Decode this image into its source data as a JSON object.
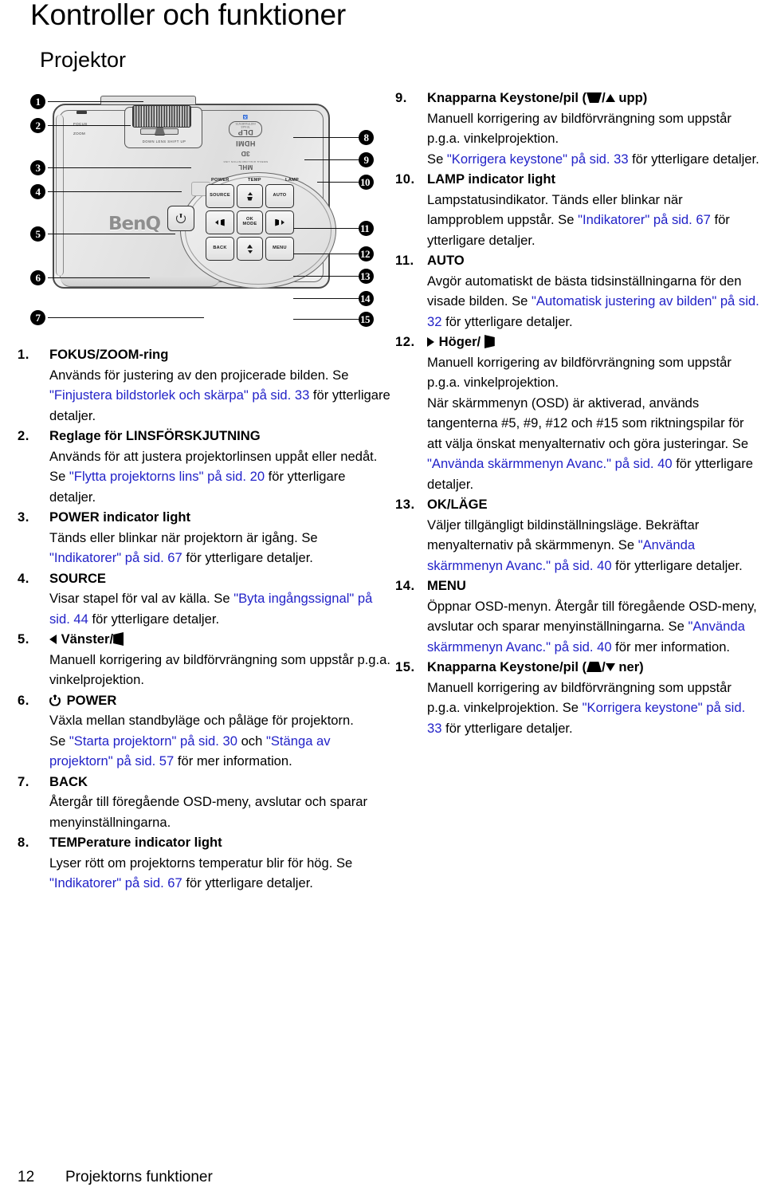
{
  "page": {
    "title": "Kontroller och funktioner",
    "subtitle": "Projektor",
    "footer_page_number": "12",
    "footer_text": "Projektorns funktioner",
    "link_color": "#2222c8"
  },
  "figure": {
    "alt_name": "projector-top-view",
    "brand": "BenQ",
    "logos": [
      {
        "name": "dlp-logo",
        "text": "DLP",
        "sub": "TEXAS INSTRUMENTS"
      },
      {
        "name": "hdmi-logo",
        "text": "HDMI"
      },
      {
        "name": "3d-logo",
        "text": "3D"
      },
      {
        "name": "mhl-logo",
        "text": "MHL",
        "sub": "MOBILE HIGH-DEFINITION LINK"
      }
    ],
    "lens_labels": {
      "focus": "FOCUS",
      "zoom": "ZOOM",
      "slider_scale": "DOWN    LENS SHIFT    UP"
    },
    "indicators": [
      "POWER",
      "TEMP",
      "LAMP"
    ],
    "keys": [
      {
        "name": "source-key",
        "label": "SOURCE"
      },
      {
        "name": "keystone-up-key",
        "label": ""
      },
      {
        "name": "auto-key",
        "label": "AUTO"
      },
      {
        "name": "left-key",
        "label": ""
      },
      {
        "name": "ok-mode-key",
        "label": "OK\nMODE"
      },
      {
        "name": "right-key",
        "label": ""
      },
      {
        "name": "back-key",
        "label": "BACK"
      },
      {
        "name": "keystone-down-key",
        "label": ""
      },
      {
        "name": "menu-key",
        "label": "MENU"
      }
    ],
    "ok_label_top": "OK",
    "ok_label_bottom": "MODE",
    "callouts": [
      "1",
      "2",
      "3",
      "4",
      "5",
      "6",
      "7",
      "8",
      "9",
      "10",
      "11",
      "12",
      "13",
      "14",
      "15"
    ]
  },
  "list_left": [
    {
      "num": "1.",
      "title": "FOKUS/ZOOM-ring",
      "parts": [
        {
          "t": "Används för justering av den projicerade bilden. Se ",
          "link": false
        },
        {
          "t": "\"Finjustera bildstorlek och skärpa\" på sid. 33",
          "link": true
        },
        {
          "t": " för ytterligare detaljer.",
          "link": false
        }
      ]
    },
    {
      "num": "2.",
      "title": "Reglage för LINSFÖRSKJUTNING",
      "parts": [
        {
          "t": "Används för att justera projektorlinsen uppåt eller nedåt. Se ",
          "link": false
        },
        {
          "t": "\"Flytta projektorns lins\" på sid. 20",
          "link": true
        },
        {
          "t": " för ytterligare detaljer.",
          "link": false
        }
      ]
    },
    {
      "num": "3.",
      "title": "POWER indicator light",
      "parts": [
        {
          "t": "Tänds eller blinkar när projektorn är igång. Se ",
          "link": false
        },
        {
          "t": "\"Indikatorer\" på sid. 67",
          "link": true
        },
        {
          "t": " för ytterligare detaljer.",
          "link": false
        }
      ]
    },
    {
      "num": "4.",
      "title": "SOURCE",
      "parts": [
        {
          "t": "Visar stapel för val av källa. Se ",
          "link": false
        },
        {
          "t": "\"Byta ingångssignal\" på sid. 44",
          "link": true
        },
        {
          "t": " för ytterligare detaljer.",
          "link": false
        }
      ]
    },
    {
      "num": "5.",
      "title_icon": "triangle-left",
      "title": "Vänster/",
      "title_icon2": "keystone-right",
      "parts": [
        {
          "t": "Manuell korrigering av bildförvrängning som uppstår p.g.a. vinkelprojektion.",
          "link": false
        }
      ]
    },
    {
      "num": "6.",
      "title_icon": "power-symbol",
      "title": "POWER",
      "parts": [
        {
          "t": "Växla mellan standbyläge och påläge för projektorn.",
          "link": false
        }
      ],
      "parts2": [
        {
          "t": "Se ",
          "link": false
        },
        {
          "t": "\"Starta projektorn\" på sid. 30",
          "link": true
        },
        {
          "t": " och ",
          "link": false
        },
        {
          "t": "\"Stänga av projektorn\" på sid. 57",
          "link": true
        },
        {
          "t": " för mer information.",
          "link": false
        }
      ]
    },
    {
      "num": "7.",
      "title": "BACK",
      "parts": [
        {
          "t": "Återgår till föregående OSD-meny, avslutar och sparar menyinställningarna.",
          "link": false
        }
      ]
    },
    {
      "num": "8.",
      "title": "TEMPerature indicator light",
      "parts": [
        {
          "t": "Lyser rött om projektorns temperatur blir för hög. Se ",
          "link": false
        },
        {
          "t": "\"Indikatorer\" på sid. 67",
          "link": true
        },
        {
          "t": " för ytterligare detaljer.",
          "link": false
        }
      ]
    }
  ],
  "list_right": [
    {
      "num": "9.",
      "title_pre": "Knapparna Keystone/pil (",
      "title_icon": "keystone-down",
      "title_mid": "/",
      "title_icon2": "triangle-up",
      "title_post": " upp)",
      "parts": [
        {
          "t": "Manuell korrigering av bildförvrängning som uppstår p.g.a. vinkelprojektion.",
          "link": false
        }
      ],
      "parts2": [
        {
          "t": "Se ",
          "link": false
        },
        {
          "t": "\"Korrigera keystone\" på sid. 33",
          "link": true
        },
        {
          "t": " för ytterligare detaljer.",
          "link": false
        }
      ]
    },
    {
      "num": "10.",
      "title": "LAMP indicator light",
      "parts": [
        {
          "t": "Lampstatusindikator. Tänds eller blinkar när lampproblem uppstår. Se ",
          "link": false
        },
        {
          "t": "\"Indikatorer\" på sid. 67",
          "link": true
        },
        {
          "t": " för ytterligare detaljer.",
          "link": false
        }
      ]
    },
    {
      "num": "11.",
      "title": "AUTO",
      "parts": [
        {
          "t": "Avgör automatiskt de bästa tidsinställningarna för den visade bilden. Se ",
          "link": false
        },
        {
          "t": "\"Automatisk justering av bilden\" på sid. 32",
          "link": true
        },
        {
          "t": " för ytterligare detaljer.",
          "link": false
        }
      ]
    },
    {
      "num": "12.",
      "title_icon": "triangle-right",
      "title": "Höger/ ",
      "title_icon2": "keystone-left",
      "parts": [
        {
          "t": "Manuell korrigering av bildförvrängning som uppstår p.g.a. vinkelprojektion.",
          "link": false
        }
      ],
      "parts2": [
        {
          "t": "När skärmmenyn (OSD) är aktiverad, används tangenterna #5, #9, #12 och #15 som riktningspilar för att välja önskat menyalternativ och göra justeringar. Se ",
          "link": false
        },
        {
          "t": "\"Använda skärmmenyn Avanc.\" på sid. 40",
          "link": true
        },
        {
          "t": " för ytterligare detaljer.",
          "link": false
        }
      ]
    },
    {
      "num": "13.",
      "title": "OK/LÄGE",
      "parts": [
        {
          "t": "Väljer tillgängligt bildinställningsläge. Bekräftar menyalternativ på skärmmenyn. Se ",
          "link": false
        },
        {
          "t": "\"Använda skärmmenyn Avanc.\" på sid. 40",
          "link": true
        },
        {
          "t": " för ytterligare detaljer.",
          "link": false
        }
      ]
    },
    {
      "num": "14.",
      "title": "MENU",
      "parts": [
        {
          "t": "Öppnar OSD-menyn. Återgår till föregående OSD-meny, avslutar och sparar menyinställningarna. Se ",
          "link": false
        },
        {
          "t": "\"Använda skärmmenyn Avanc.\" på sid. 40",
          "link": true
        },
        {
          "t": "  för mer information.",
          "link": false
        }
      ]
    },
    {
      "num": "15.",
      "title_pre": "Knapparna Keystone/pil (",
      "title_icon": "keystone-up",
      "title_mid": "/",
      "title_icon2": "triangle-down",
      "title_post": " ner)",
      "parts": [
        {
          "t": "Manuell korrigering av bildförvrängning som uppstår p.g.a. vinkelprojektion. Se ",
          "link": false
        },
        {
          "t": "\"Korrigera keystone\" på sid. 33",
          "link": true
        },
        {
          "t": " för ytterligare detaljer.",
          "link": false
        }
      ]
    }
  ]
}
